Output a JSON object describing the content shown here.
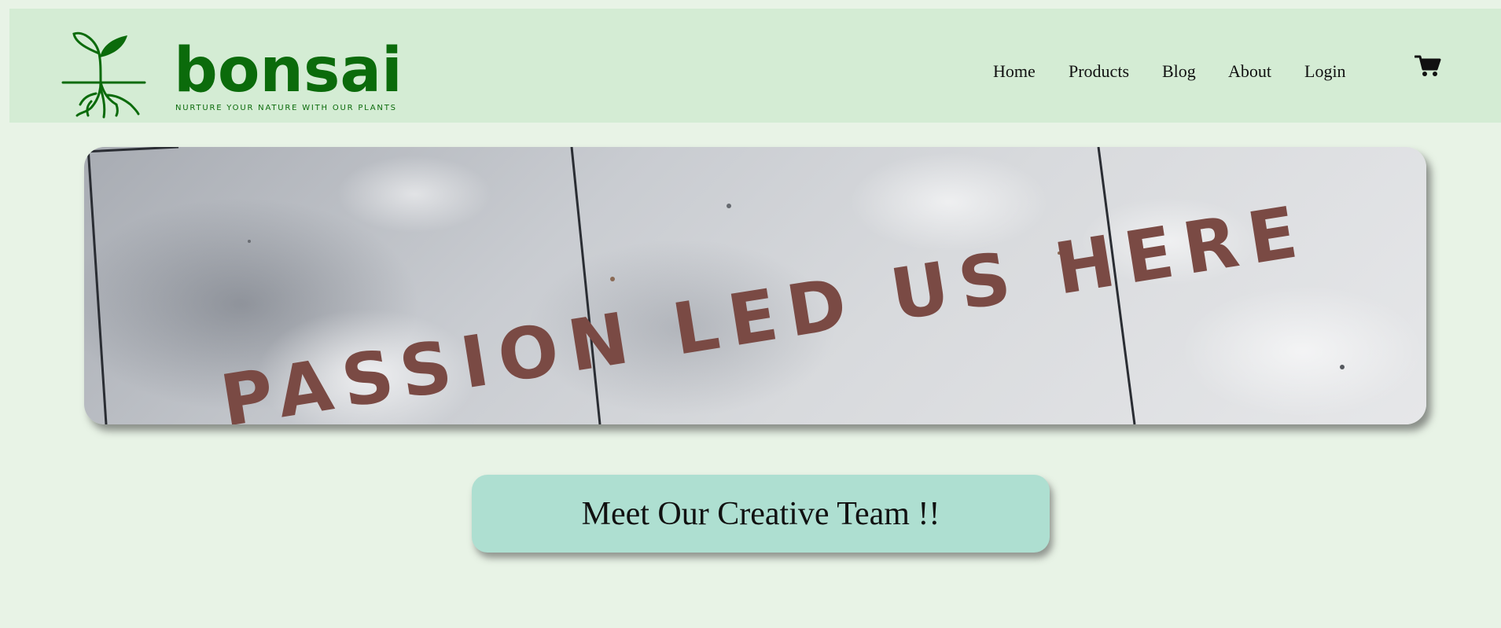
{
  "header": {
    "logo": {
      "wordmark": "bonsai",
      "tagline": "NURTURE YOUR NATURE WITH OUR PLANTS",
      "icon": "sprout-roots-icon"
    },
    "nav": [
      {
        "label": "Home"
      },
      {
        "label": "Products"
      },
      {
        "label": "Blog"
      },
      {
        "label": "About"
      },
      {
        "label": "Login"
      }
    ],
    "cart_icon": "shopping-cart-icon"
  },
  "hero": {
    "text": "PASSION LED US HERE"
  },
  "cta": {
    "label": "Meet Our Creative Team !!"
  },
  "colors": {
    "page_background": "#e8f3e6",
    "header_background": "#d4ecd4",
    "brand_green": "#0b6b0b",
    "button_background": "#aedfd1",
    "hero_text": "#7a4a44"
  }
}
